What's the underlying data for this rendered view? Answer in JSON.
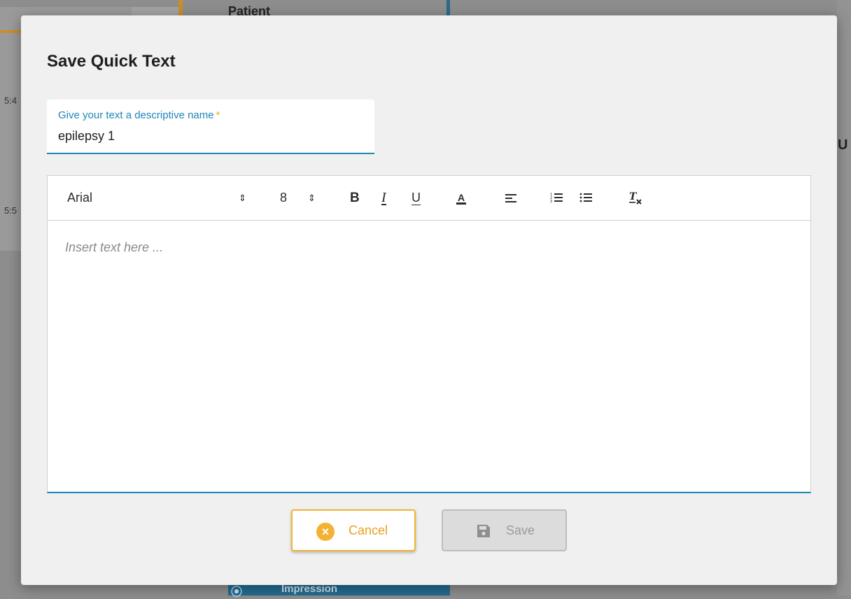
{
  "background": {
    "header_partial": "Patient",
    "times": [
      "5:4",
      "5:5"
    ],
    "column_partial": "U",
    "bottom_tab_label": "Impression"
  },
  "dialog": {
    "title": "Save Quick Text",
    "name_field": {
      "label": "Give your text a descriptive name",
      "required_marker": "*",
      "value": "epilepsy 1"
    },
    "editor": {
      "font": "Arial",
      "size": "8",
      "updown_glyph": "⇕",
      "bold": "B",
      "italic": "I",
      "underline": "U",
      "text_color": "A",
      "placeholder": "Insert text here ..."
    },
    "buttons": {
      "cancel_label": "Cancel",
      "save_label": "Save"
    }
  },
  "colors": {
    "accent_blue": "#1e86b8",
    "accent_orange": "#f4b234",
    "dialog_bg": "#f0f0f0"
  }
}
